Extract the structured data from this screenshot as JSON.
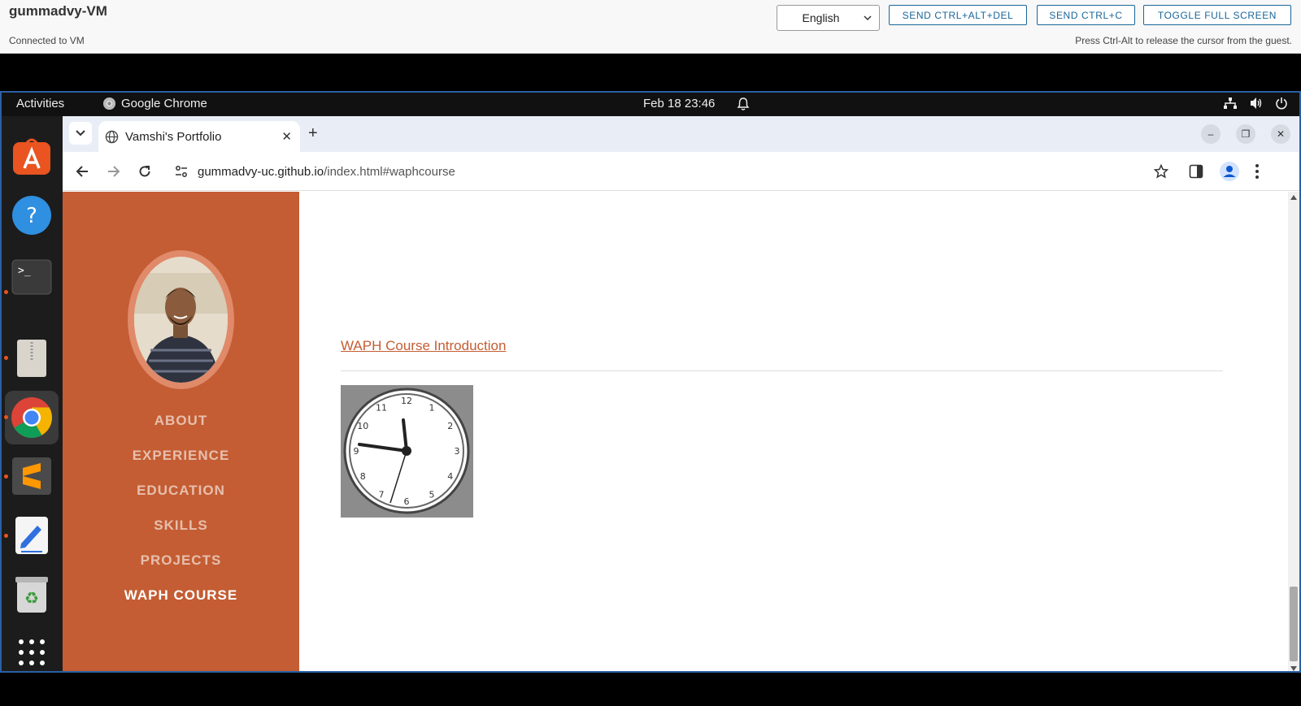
{
  "vm": {
    "title": "gummadvy-VM",
    "status": "Connected to VM",
    "hint": "Press Ctrl-Alt to release the cursor from the guest.",
    "language": "English",
    "buttons": {
      "ctrl_alt_del": "SEND CTRL+ALT+DEL",
      "ctrl_c": "SEND CTRL+C",
      "fullscreen": "TOGGLE FULL SCREEN"
    }
  },
  "desktop": {
    "activities": "Activities",
    "app_name": "Google Chrome",
    "datetime": "Feb 18  23:46",
    "dock": [
      "app-center",
      "help",
      "terminal",
      "archive-manager",
      "google-chrome",
      "sublime-text",
      "text-editor",
      "trash",
      "show-apps"
    ]
  },
  "browser": {
    "tab_title": "Vamshi's Portfolio",
    "url_host": "gummadvy-uc.github.io",
    "url_path": "/index.html#waphcourse"
  },
  "page": {
    "nav": [
      "ABOUT",
      "EXPERIENCE",
      "EDUCATION",
      "SKILLS",
      "PROJECTS",
      "WAPH COURSE"
    ],
    "active_nav": "WAPH COURSE",
    "course_link": "WAPH Course Introduction",
    "clock_numbers": [
      "12",
      "1",
      "2",
      "3",
      "4",
      "5",
      "6",
      "7",
      "8",
      "9",
      "10",
      "11"
    ],
    "accent_color": "#c45d33"
  }
}
